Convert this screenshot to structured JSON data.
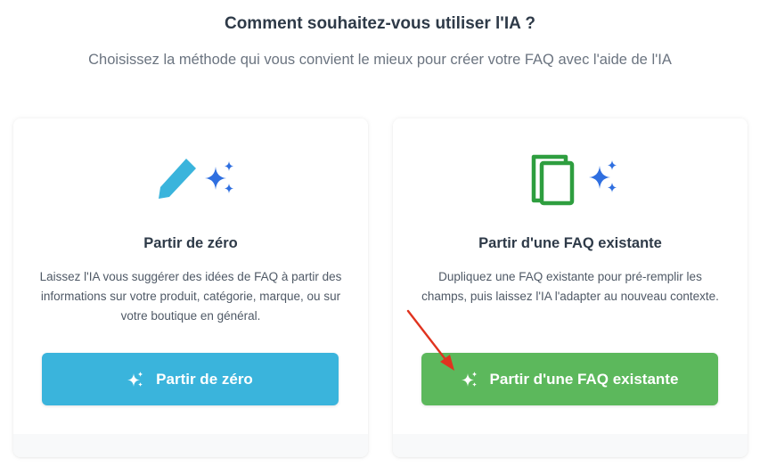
{
  "header": {
    "title": "Comment souhaitez-vous utiliser l'IA ?",
    "subtitle": "Choisissez la méthode qui vous convient le mieux pour créer votre FAQ avec l'aide de l'IA"
  },
  "cards": [
    {
      "icon": "pencil-icon",
      "accent_color": "#3ab4dc",
      "title": "Partir de zéro",
      "description": "Laissez l'IA vous suggérer des idées de FAQ à partir des informations sur votre produit, catégorie, marque, ou sur votre boutique en général.",
      "button_label": "Partir de zéro"
    },
    {
      "icon": "copy-icon",
      "accent_color": "#5cb85c",
      "title": "Partir d'une FAQ existante",
      "description": "Dupliquez une FAQ existante pour pré-remplir les champs, puis laissez l'IA l'adapter au nouveau contexte.",
      "button_label": "Partir d'une FAQ existante"
    }
  ],
  "colors": {
    "sparkle": "#2f6fe0",
    "annotation_arrow": "#e0331f"
  }
}
